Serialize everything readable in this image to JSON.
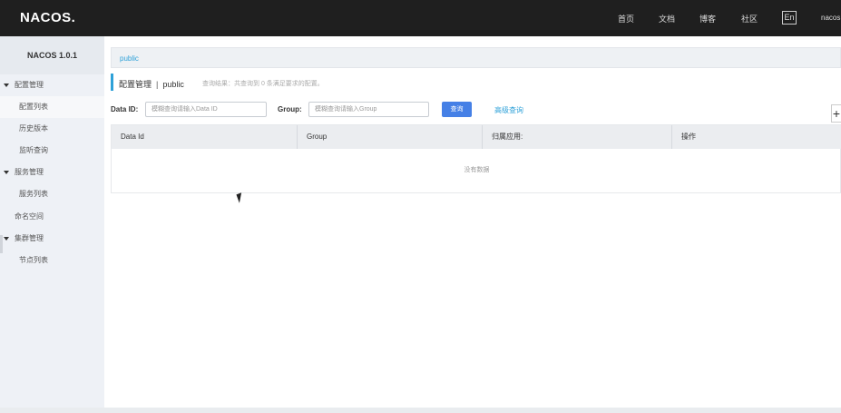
{
  "header": {
    "logo": "NACOS.",
    "nav": [
      "首页",
      "文档",
      "博客",
      "社区"
    ],
    "lang": "En",
    "user": "nacos"
  },
  "sidebar": {
    "title": "NACOS 1.0.1",
    "items": [
      {
        "label": "配置管理",
        "type": "group"
      },
      {
        "label": "配置列表",
        "type": "sub",
        "active": true
      },
      {
        "label": "历史版本",
        "type": "sub"
      },
      {
        "label": "监听查询",
        "type": "sub"
      },
      {
        "label": "服务管理",
        "type": "group"
      },
      {
        "label": "服务列表",
        "type": "sub"
      },
      {
        "label": "命名空间",
        "type": "top"
      },
      {
        "label": "集群管理",
        "type": "group"
      },
      {
        "label": "节点列表",
        "type": "sub"
      }
    ]
  },
  "main": {
    "namespace": "public",
    "title": "配置管理",
    "title_ns": "public",
    "hint": "查询结果：共查询到 0 条满足要求的配置。",
    "filters": {
      "dataid_label": "Data ID:",
      "dataid_placeholder": "模糊查询请输入Data ID",
      "group_label": "Group:",
      "group_placeholder": "模糊查询请输入Group",
      "query_label": "查询",
      "advanced_label": "高级查询",
      "add_label": "+"
    },
    "table": {
      "columns": [
        "Data Id",
        "Group",
        "归属应用:",
        "操作"
      ],
      "empty_text": "没有数据"
    }
  },
  "colors": {
    "topbar": "#1f1f1f",
    "accent": "#2ea1d8",
    "primary_button": "#4580e6"
  }
}
